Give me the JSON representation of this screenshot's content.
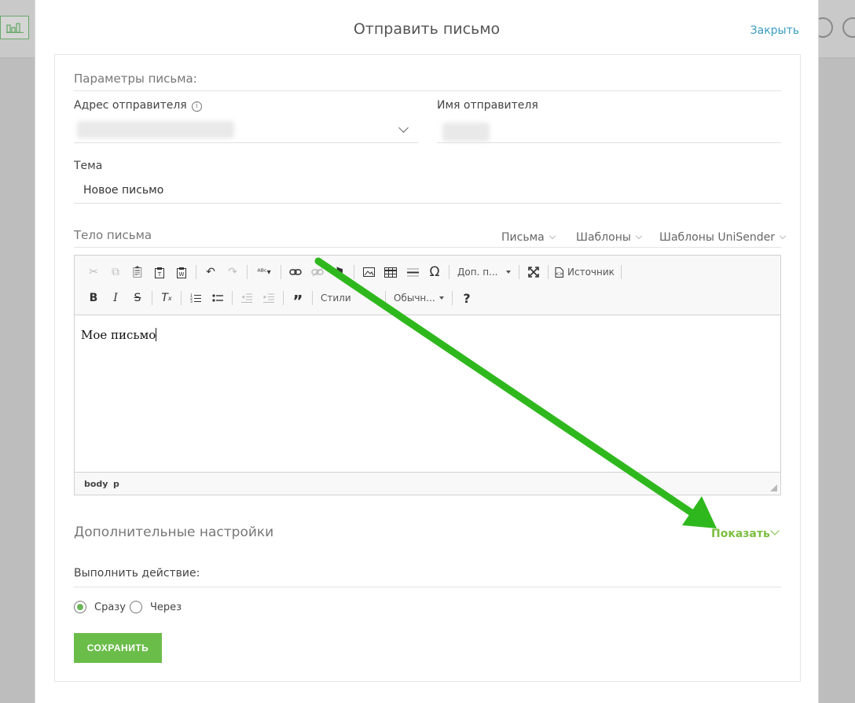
{
  "dialog": {
    "title": "Отправить письмо",
    "close_label": "Закрыть"
  },
  "params": {
    "section_title": "Параметры письма:",
    "sender_address_label": "Адрес отправителя",
    "sender_name_label": "Имя отправителя",
    "subject_label": "Тема",
    "subject_value": "Новое письмо"
  },
  "body_section": {
    "title": "Тело письма",
    "menus": [
      "Письма",
      "Шаблоны",
      "Шаблоны UniSender"
    ]
  },
  "editor": {
    "row1": {
      "extra_combo": "Доп. п...",
      "source_label": "Источник"
    },
    "row2": {
      "styles_combo": "Стили",
      "format_combo": "Обычн..."
    },
    "content_text": "Мое письмо",
    "path": [
      "body",
      "p"
    ]
  },
  "advanced": {
    "title": "Дополнительные настройки",
    "toggle_label": "Показать"
  },
  "action": {
    "label": "Выполнить действие:",
    "options": [
      "Сразу",
      "Через"
    ],
    "selected": "Сразу"
  },
  "save_label": "СОХРАНИТЬ",
  "colors": {
    "accent_green": "#6bbd4a",
    "link_blue": "#3a9cbf",
    "annotation_arrow": "#2fb81d"
  }
}
